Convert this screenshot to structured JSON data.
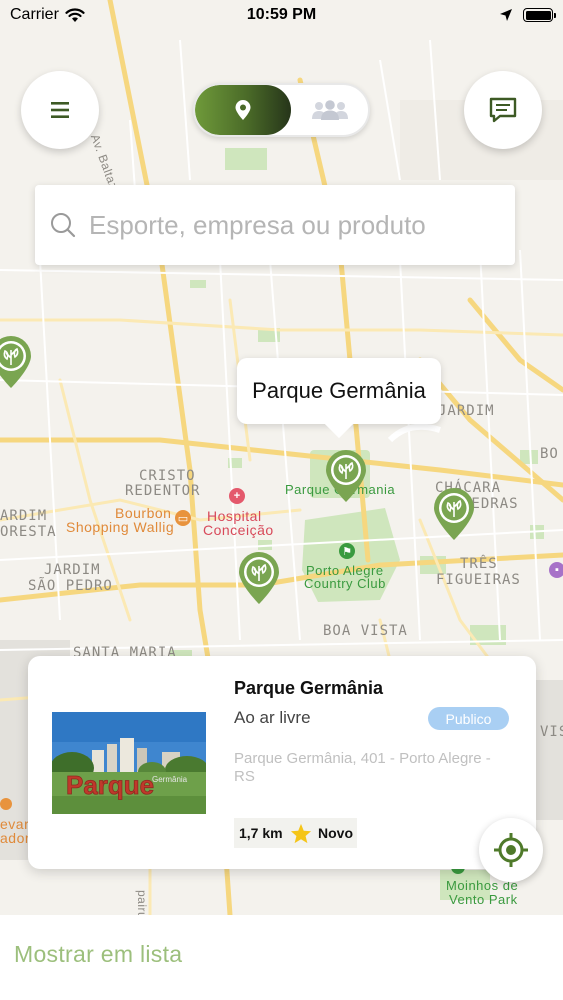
{
  "status_bar": {
    "carrier": "Carrier",
    "time": "10:59 PM",
    "icons": [
      "wifi-icon",
      "location-arrow-icon",
      "battery-icon"
    ]
  },
  "header": {
    "menu_icon": "hamburger-menu-icon",
    "chat_icon": "chat-bubble-icon",
    "view_toggle": {
      "active": "map",
      "options": [
        "map-pin-icon",
        "people-icon"
      ]
    }
  },
  "search": {
    "placeholder": "Esporte, empresa ou produto",
    "icon": "search-icon"
  },
  "map": {
    "labels": {
      "av_baltazar": "Av. Baltazar de",
      "jardim": "JARDIM",
      "bo": "BO",
      "cristo": "CRISTO",
      "redentor": "REDENTOR",
      "chacara": "CHÁCARA",
      "pedras": "PEDRAS",
      "ardim": "ARDIM",
      "oresta": "ORESTA",
      "bourbon": "Bourbon",
      "shopping_wallig": "Shopping Wallig",
      "hospital": "Hospital",
      "conceicao": "Conceição",
      "parque_germania_map": "Parque Germania",
      "jardim_sao_pedro_1": "JARDIM",
      "jardim_sao_pedro_2": "SÃO PEDRO",
      "porto_alegre": "Porto Alegre",
      "country_club": "Country Club",
      "tres": "TRÊS",
      "figueiras": "FIGUEIRAS",
      "boa_vista": "BOA VISTA",
      "santa_maria": "SANTA MARIA",
      "vis": "VIS",
      "evar": "evar",
      "ador": "ador",
      "moinhos_1": "Moinhos de",
      "moinhos_2": "Vento Park",
      "pairu": "pairu"
    },
    "pin_icon": "leaf-pin-icon",
    "callout": "Parque Germânia",
    "colors": {
      "pin": "#7aa551",
      "park": "#cfe6bd",
      "road": "#f9df9a"
    }
  },
  "card": {
    "title": "Parque Germânia",
    "category": "Ao ar livre",
    "badge": "Publico",
    "address": "Parque Germânia, 401 - Porto Alegre - RS",
    "distance": "1,7 km",
    "rating_icon": "star-icon",
    "rating": "Novo",
    "image_text": "Parque",
    "colors": {
      "badge": "#a9cff3",
      "star": "#f5c518"
    }
  },
  "locate_icon": "crosshair-icon",
  "bottom": {
    "show_list": "Mostrar em lista"
  }
}
